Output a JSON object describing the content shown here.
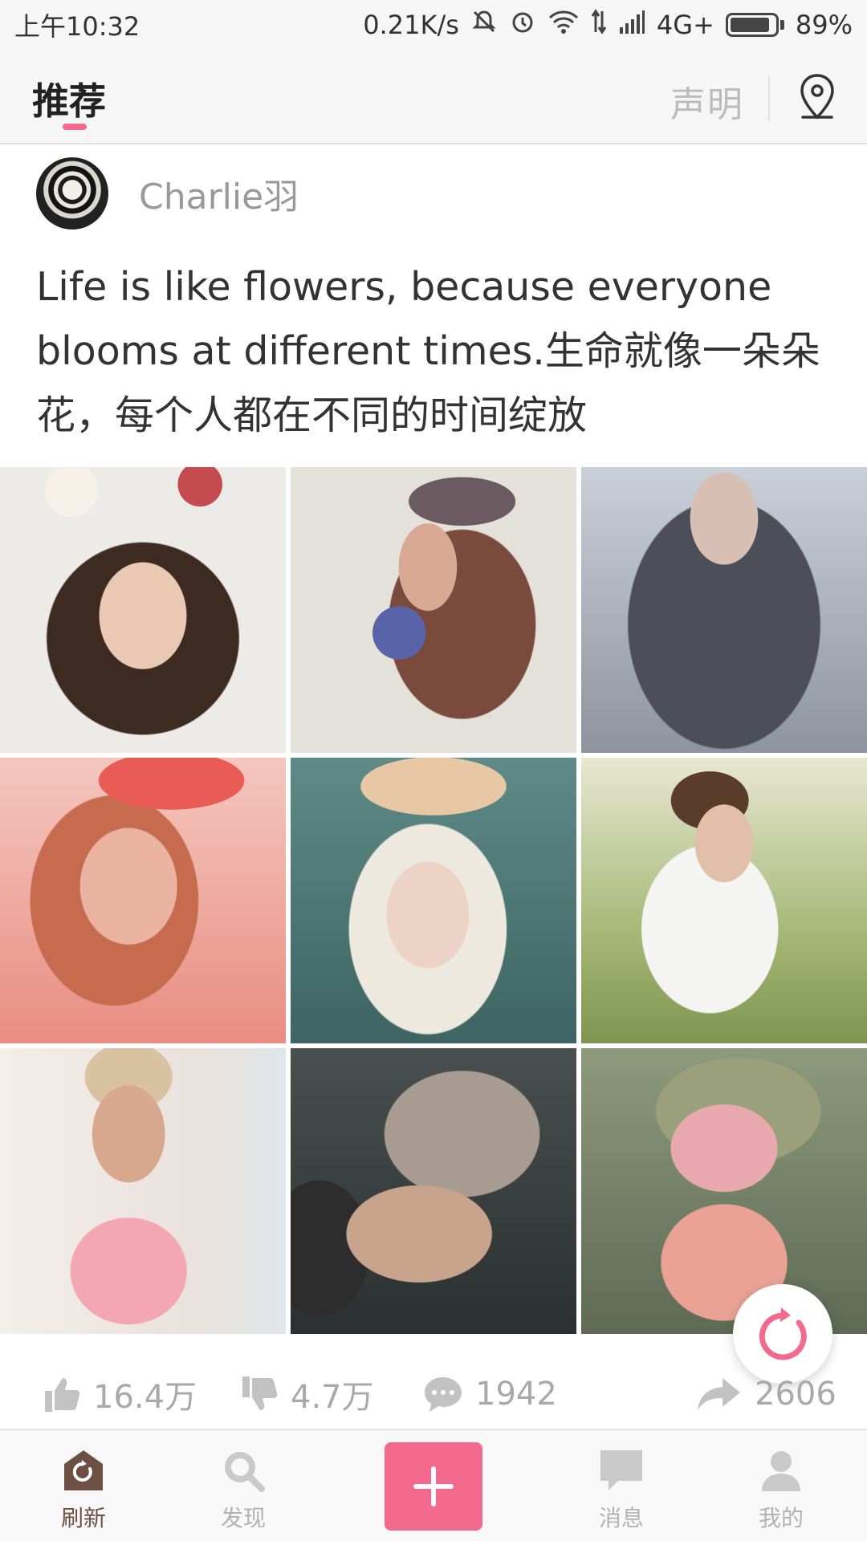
{
  "status_bar": {
    "time": "上午10:32",
    "net_speed": "0.21K/s",
    "network": "4G+",
    "battery": "89%",
    "battery_level": 0.89,
    "icons": [
      "mute-icon",
      "alarm-icon",
      "wifi-icon",
      "data-arrows-icon",
      "signal-icon",
      "battery-icon"
    ]
  },
  "header": {
    "active_tab": "推荐",
    "statement": "声明",
    "location_icon": "map-pin-icon",
    "accent_color": "#f36a8b"
  },
  "post": {
    "author": "Charlie羽",
    "text": "Life is like flowers, because everyone blooms at different times.生命就像一朵朵花，每个人都在不同的时间绽放",
    "images": [
      "flower-crown-portrait-1",
      "flower-crown-portrait-2",
      "flower-crown-portrait-3",
      "flower-crown-portrait-4",
      "flower-crown-portrait-5",
      "flower-crown-portrait-6",
      "flower-crown-portrait-7",
      "flower-crown-portrait-8",
      "flower-crown-portrait-9"
    ],
    "likes": "16.4万",
    "dislikes": "4.7万",
    "comments": "1942",
    "shares": "2606"
  },
  "bottom_nav": {
    "items": [
      {
        "label": "刷新",
        "icon": "home-refresh-icon",
        "active": true
      },
      {
        "label": "发现",
        "icon": "search-icon",
        "active": false
      },
      {
        "label": "",
        "icon": "plus-icon",
        "active": false
      },
      {
        "label": "消息",
        "icon": "message-icon",
        "active": false
      },
      {
        "label": "我的",
        "icon": "person-icon",
        "active": false
      }
    ],
    "add_button_color": "#f3688d"
  }
}
